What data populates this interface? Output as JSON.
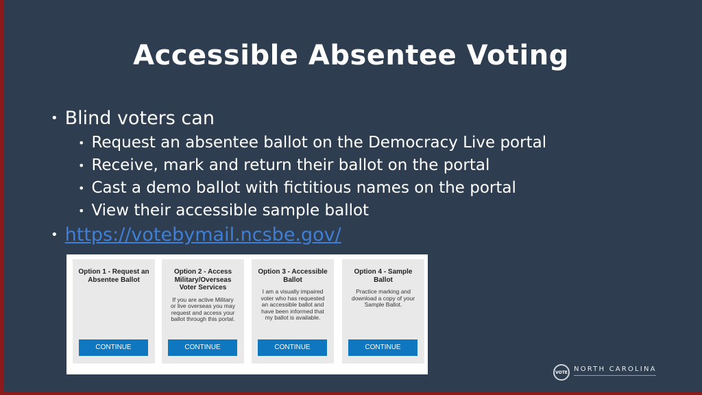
{
  "slide": {
    "title": "Accessible Absentee Voting",
    "bullets": {
      "main": "Blind voters can",
      "subs": [
        "Request an absentee ballot on the Democracy Live portal",
        "Receive, mark and return their ballot on the portal",
        "Cast a demo ballot with fictitious names on the portal",
        "View their accessible sample ballot"
      ],
      "link": "https://votebymail.ncsbe.gov/"
    }
  },
  "portal": {
    "options": [
      {
        "title": "Option 1 - Request an Absentee Ballot",
        "desc": "",
        "button": "CONTINUE"
      },
      {
        "title": "Option 2 - Access Military/Overseas Voter Services",
        "desc": "If you are active Military or live overseas you may request and access your ballot through this portal.",
        "button": "CONTINUE"
      },
      {
        "title": "Option 3 - Accessible Ballot",
        "desc": "I am a visually impaired voter who has requested an accessible ballot and have been informed that my ballot is available.",
        "button": "CONTINUE"
      },
      {
        "title": "Option 4 - Sample Ballot",
        "desc": "Practice marking and download a copy of your Sample Ballot.",
        "button": "CONTINUE"
      }
    ]
  },
  "logo": {
    "seal_text": "VOTE",
    "name": "NORTH CAROLINA"
  },
  "colors": {
    "background": "#2e3e50",
    "accent_bar": "#8b1a1a",
    "link": "#3f7fd6",
    "button": "#0e77bf"
  }
}
